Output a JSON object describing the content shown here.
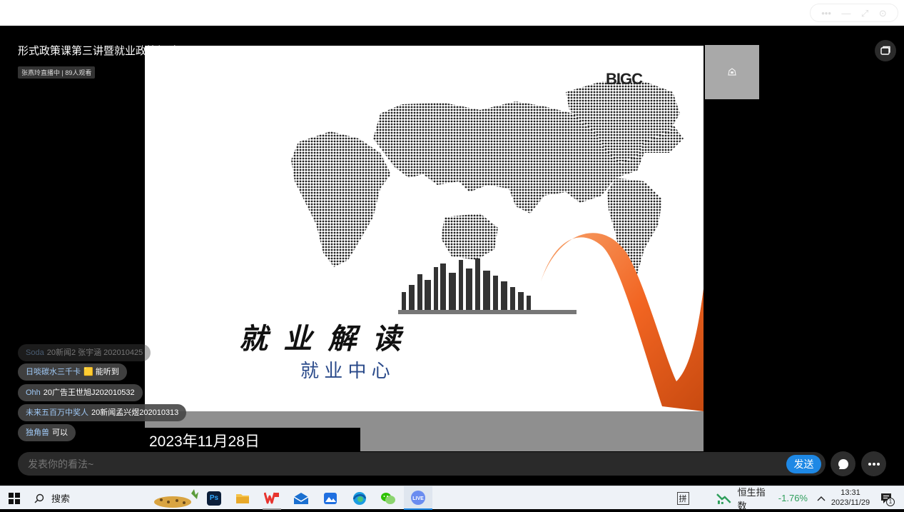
{
  "window": {
    "controls": [
      "•••",
      "—",
      "⤢",
      "⊙"
    ]
  },
  "live": {
    "title": "形式政策课第三讲暨就业政策解读",
    "status_badge": "张燕玲直播中 | 89人观看",
    "slide": {
      "logo": "BIGC",
      "heading": "就  业  解  读",
      "subheading": "就 业 中 心",
      "date": "2023年11月28日"
    },
    "chat": [
      {
        "user": "Soda",
        "text": "20新闻2 张宇涵 202010425",
        "faded": true
      },
      {
        "user": "日啖碳水三千卡",
        "text": "🟨 能听到",
        "faded": false
      },
      {
        "user": "Ohh",
        "text": "20广告王世旭J202010532",
        "faded": false
      },
      {
        "user": "未来五百万中奖人",
        "text": "20新闻孟兴煜202010313",
        "faded": false
      },
      {
        "user": "独角兽",
        "text": "可以",
        "faded": false
      }
    ],
    "input_placeholder": "发表你的看法~",
    "send_label": "发送"
  },
  "taskbar": {
    "search_label": "搜索",
    "ime_label": "拼",
    "stock_label": "恒生指数",
    "stock_change": "-1.76%",
    "time": "13:31",
    "date": "2023/11/29",
    "notification_count": "1"
  },
  "colors": {
    "accent": "#1e88e5",
    "stock_positive": "#2e9e5b",
    "slide_orange": "#f26522"
  }
}
